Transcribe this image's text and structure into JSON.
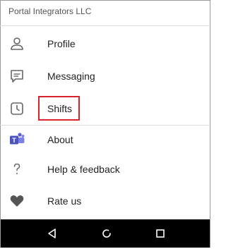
{
  "header": {
    "org_name": "Portal Integrators LLC"
  },
  "menu": {
    "items": [
      {
        "label": "Profile",
        "icon": "person-icon"
      },
      {
        "label": "Messaging",
        "icon": "message-icon"
      },
      {
        "label": "Shifts",
        "icon": "clock-icon",
        "highlighted": true
      },
      {
        "label": "About",
        "icon": "teams-icon"
      },
      {
        "label": "Help & feedback",
        "icon": "question-icon"
      },
      {
        "label": "Rate us",
        "icon": "heart-icon"
      }
    ]
  },
  "colors": {
    "highlight": "#d8232a",
    "teams_purple": "#5b5fc7",
    "icon_gray": "#666666",
    "navbar": "#000000"
  },
  "navbar": {
    "buttons": [
      "back-icon",
      "home-icon",
      "recents-icon"
    ]
  }
}
